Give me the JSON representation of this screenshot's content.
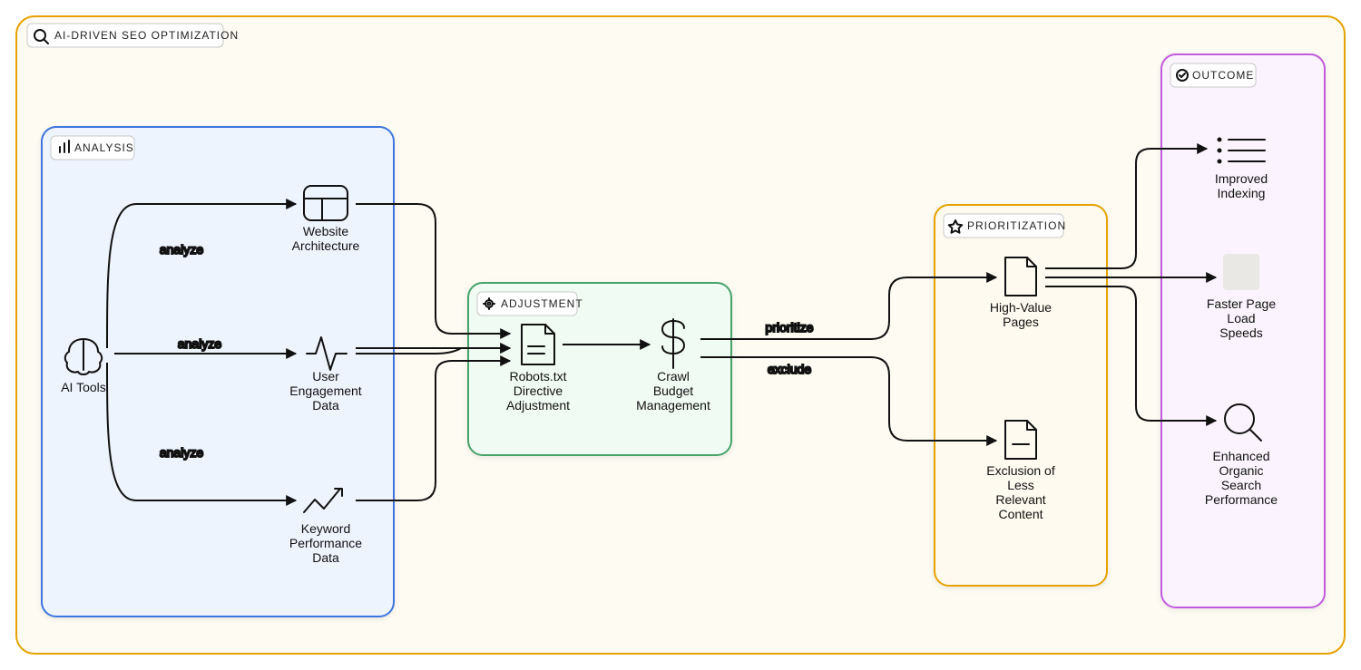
{
  "diagram": {
    "title": "AI-DRIVEN SEO OPTIMIZATION",
    "groups": {
      "analysis": {
        "label": "ANALYSIS"
      },
      "adjustment": {
        "label": "ADJUSTMENT"
      },
      "prioritization": {
        "label": "PRIORITIZATION"
      },
      "outcome": {
        "label": "OUTCOME"
      }
    },
    "nodes": {
      "ai_tools": {
        "label": "AI Tools"
      },
      "website_arch": {
        "label": "Website\nArchitecture"
      },
      "user_engagement": {
        "label": "User\nEngagement\nData"
      },
      "keyword_perf": {
        "label": "Keyword\nPerformance\nData"
      },
      "robots": {
        "label": "Robots.txt\nDirective\nAdjustment"
      },
      "crawl_budget": {
        "label": "Crawl\nBudget\nManagement"
      },
      "high_value": {
        "label": "High-Value\nPages"
      },
      "exclusion": {
        "label": "Exclusion of\nLess\nRelevant\nContent"
      },
      "improved_indexing": {
        "label": "Improved\nIndexing"
      },
      "faster_speeds": {
        "label": "Faster Page\nLoad\nSpeeds"
      },
      "enhanced_search": {
        "label": "Enhanced\nOrganic\nSearch\nPerformance"
      }
    },
    "edges": {
      "analyze": "analyze",
      "prioritize": "prioritize",
      "exclude": "exclude"
    },
    "colors": {
      "page_bg": "#FDFBF2",
      "page_border": "#E6A203",
      "analysis_fill": "#EEF4FE",
      "analysis_border": "#3C74DE",
      "adjustment_fill": "#F0FBF4",
      "adjustment_border": "#47A36B",
      "prioritization_fill": "#FEFAEF",
      "prioritization_border": "#E6A203",
      "outcome_fill": "#FBF4FE",
      "outcome_border": "#C25ADF",
      "arrow": "#111111"
    }
  }
}
